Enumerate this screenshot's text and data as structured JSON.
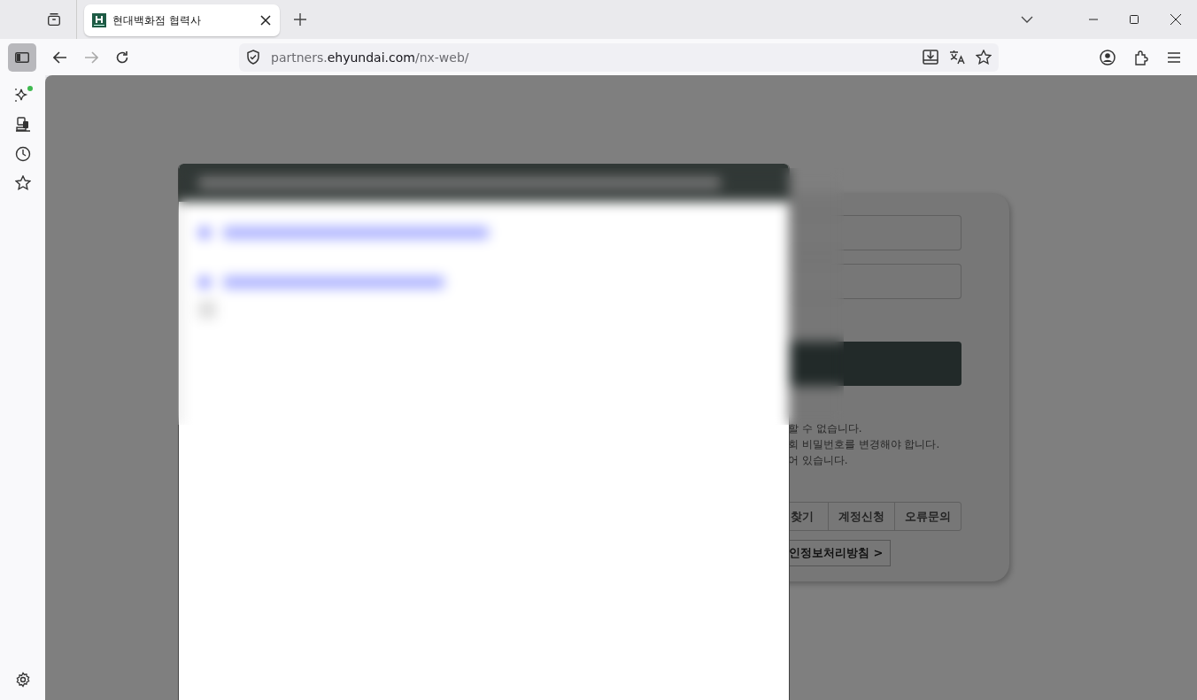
{
  "browser": {
    "tabs": [
      {
        "title": "현대백화점 협력사",
        "selected": true
      }
    ],
    "address": {
      "prefix": "partners.",
      "domain": "ehyundai.com",
      "path": "/nx-web/"
    }
  },
  "login_card": {
    "notices": [
      "할 수 없습니다.",
      "회 비밀번호를 변경해야 합니다.",
      "어 있습니다."
    ],
    "links": [
      "찾기",
      "계정신청",
      "오류문의"
    ],
    "policy_link": "인정보처리방침 >"
  }
}
